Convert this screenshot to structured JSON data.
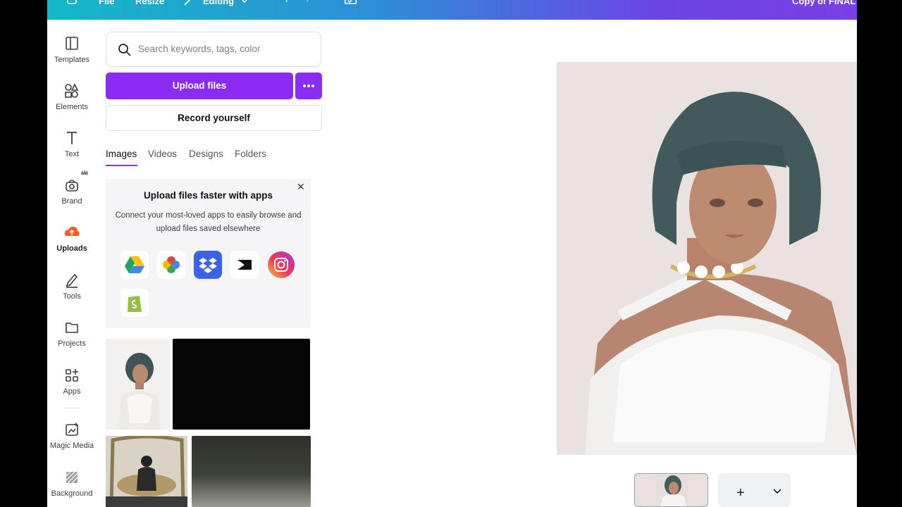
{
  "topbar": {
    "file_label": "File",
    "resize_label": "Resize",
    "editing_label": "Editing",
    "doc_title": "Copy of FINAL"
  },
  "rail": {
    "items": [
      {
        "label": "Templates",
        "icon": "templates-icon"
      },
      {
        "label": "Elements",
        "icon": "elements-icon"
      },
      {
        "label": "Text",
        "icon": "text-icon"
      },
      {
        "label": "Brand",
        "icon": "brand-icon"
      },
      {
        "label": "Uploads",
        "icon": "upload-cloud-icon"
      },
      {
        "label": "Tools",
        "icon": "pen-icon"
      },
      {
        "label": "Projects",
        "icon": "folder-icon"
      },
      {
        "label": "Apps",
        "icon": "apps-icon"
      },
      {
        "label": "Magic Media",
        "icon": "magic-media-icon"
      },
      {
        "label": "Background",
        "icon": "background-icon"
      }
    ]
  },
  "panel": {
    "search_placeholder": "Search keywords, tags, color",
    "upload_label": "Upload files",
    "record_label": "Record yourself",
    "tabs": [
      "Images",
      "Videos",
      "Designs",
      "Folders"
    ],
    "promo": {
      "title": "Upload files faster with apps",
      "description": "Connect your most-loved apps to easily browse and upload files saved elsewhere",
      "apps": [
        "google-drive-icon",
        "google-photos-icon",
        "dropbox-icon",
        "capcut-icon",
        "instagram-icon",
        "shopify-icon"
      ]
    }
  },
  "colors": {
    "accent": "#8b2cf5",
    "topbar_start": "#14b8c8",
    "topbar_end": "#7b3fe4"
  }
}
